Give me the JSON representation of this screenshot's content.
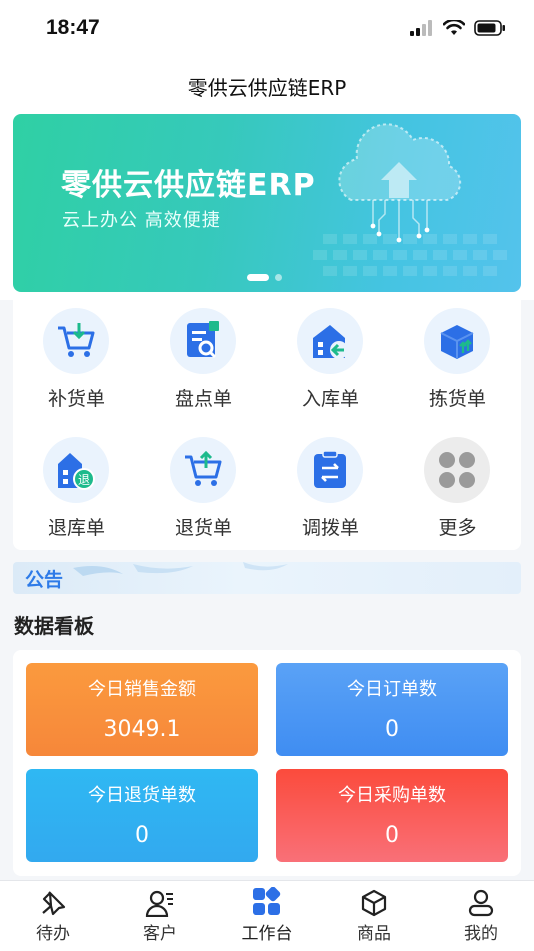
{
  "status": {
    "time": "18:47"
  },
  "nav": {
    "title": "零供云供应链ERP"
  },
  "banner": {
    "title": "零供云供应链ERP",
    "subtitle": "云上办公  高效便捷",
    "slide_index": 1,
    "slide_count": 2
  },
  "quick_actions": [
    {
      "label": "补货单",
      "icon": "cart-download-icon"
    },
    {
      "label": "盘点单",
      "icon": "document-search-icon"
    },
    {
      "label": "入库单",
      "icon": "warehouse-in-icon"
    },
    {
      "label": "拣货单",
      "icon": "box-icon"
    },
    {
      "label": "退库单",
      "icon": "warehouse-return-icon"
    },
    {
      "label": "退货单",
      "icon": "cart-upload-icon"
    },
    {
      "label": "调拨单",
      "icon": "transfer-icon"
    },
    {
      "label": "更多",
      "icon": "more-grid-icon"
    }
  ],
  "notice": {
    "label": "公告"
  },
  "dashboard": {
    "title": "数据看板",
    "stats": [
      {
        "label": "今日销售金额",
        "value": "3049.1",
        "color_from": "#fb9a3e",
        "color_to": "#f6873a"
      },
      {
        "label": "今日订单数",
        "value": "0",
        "color_from": "#5aa2f6",
        "color_to": "#3f8df2"
      },
      {
        "label": "今日退货单数",
        "value": "0",
        "color_from": "#2fb8f3",
        "color_to": "#32a9ef"
      },
      {
        "label": "今日采购单数",
        "value": "0",
        "color_from": "#fb4b3c",
        "color_to": "#f97078"
      }
    ]
  },
  "tabs": [
    {
      "label": "待办",
      "icon": "pin-icon"
    },
    {
      "label": "客户",
      "icon": "customer-icon"
    },
    {
      "label": "工作台",
      "icon": "workbench-icon",
      "active": true
    },
    {
      "label": "商品",
      "icon": "product-box-icon"
    },
    {
      "label": "我的",
      "icon": "profile-icon"
    }
  ],
  "colors": {
    "accent": "#2e7be8",
    "banner_from": "#2fd0a4",
    "banner_to": "#54c3ec"
  }
}
